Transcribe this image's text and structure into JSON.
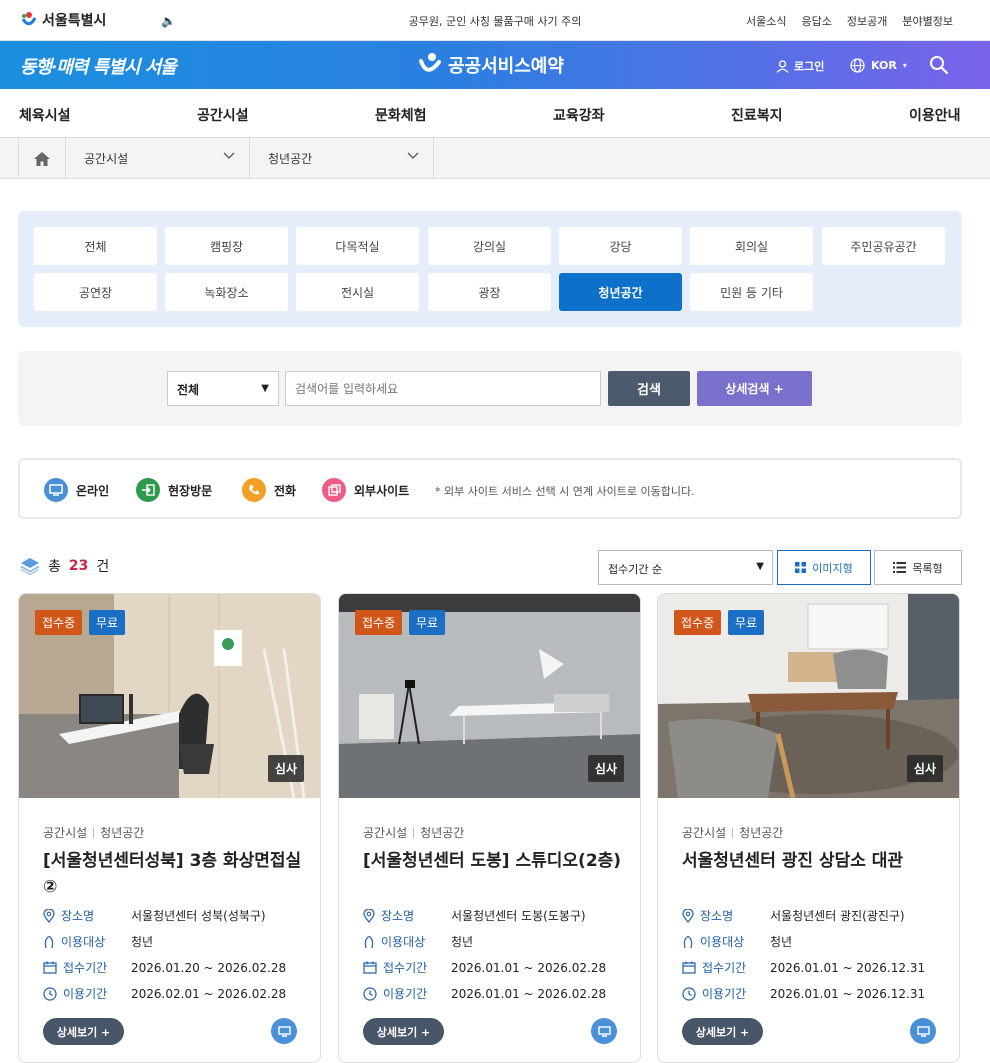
{
  "top": {
    "logo_text": "서울특별시",
    "notice": "공무원, 군인 사칭 물품구매 사기 주의",
    "links": [
      "서울소식",
      "응답소",
      "정보공개",
      "분야별정보"
    ]
  },
  "banner": {
    "slogan": "동행·매력 특별시 서울",
    "brand": "공공서비스예약",
    "login": "로그인",
    "lang": "KOR"
  },
  "gnb": [
    "체육시설",
    "공간시설",
    "문화체험",
    "교육강좌",
    "진료복지",
    "이용안내"
  ],
  "breadcrumb": {
    "level1": "공간시설",
    "level2": "청년공간"
  },
  "categories": [
    {
      "label": "전체",
      "active": false
    },
    {
      "label": "캠핑장",
      "active": false
    },
    {
      "label": "다목적실",
      "active": false
    },
    {
      "label": "강의실",
      "active": false
    },
    {
      "label": "강당",
      "active": false
    },
    {
      "label": "회의실",
      "active": false
    },
    {
      "label": "주민공유공간",
      "active": false
    },
    {
      "label": "공연장",
      "active": false
    },
    {
      "label": "녹화장소",
      "active": false
    },
    {
      "label": "전시실",
      "active": false
    },
    {
      "label": "광장",
      "active": false
    },
    {
      "label": "청년공간",
      "active": true
    },
    {
      "label": "민원 등 기타",
      "active": false
    }
  ],
  "search": {
    "scope": "전체",
    "placeholder": "검색어를 입력하세요",
    "button": "검색",
    "advanced": "상세검색 +"
  },
  "legend": {
    "online": "온라인",
    "visit": "현장방문",
    "phone": "전화",
    "external": "외부사이트",
    "note": "* 외부 사이트 서비스 선택 시 연계 사이트로 이동합니다."
  },
  "results": {
    "prefix": "총",
    "count": "23",
    "suffix": "건",
    "sort": "접수기간 순",
    "view_image": "이미지형",
    "view_list": "목록형"
  },
  "card_labels": {
    "status": "접수중",
    "fee": "무료",
    "review": "심사",
    "place": "장소명",
    "target": "이용대상",
    "receipt": "접수기간",
    "use": "이용기간",
    "more": "상세보기 +"
  },
  "cards": [
    {
      "cat1": "공간시설",
      "cat2": "청년공간",
      "title": "[서울청년센터성북] 3층 화상면접실 ②",
      "place": "서울청년센터 성북(성북구)",
      "target": "청년",
      "receipt": "2026.01.20 ~ 2026.02.28",
      "use": "2026.02.01 ~ 2026.02.28"
    },
    {
      "cat1": "공간시설",
      "cat2": "청년공간",
      "title": "[서울청년센터 도봉] 스튜디오(2층)",
      "place": "서울청년센터 도봉(도봉구)",
      "target": "청년",
      "receipt": "2026.01.01 ~ 2026.02.28",
      "use": "2026.01.01 ~ 2026.02.28"
    },
    {
      "cat1": "공간시설",
      "cat2": "청년공간",
      "title": "서울청년센터 광진 상담소 대관",
      "place": "서울청년센터 광진(광진구)",
      "target": "청년",
      "receipt": "2026.01.01 ~ 2026.12.31",
      "use": "2026.01.01 ~ 2026.12.31"
    }
  ]
}
